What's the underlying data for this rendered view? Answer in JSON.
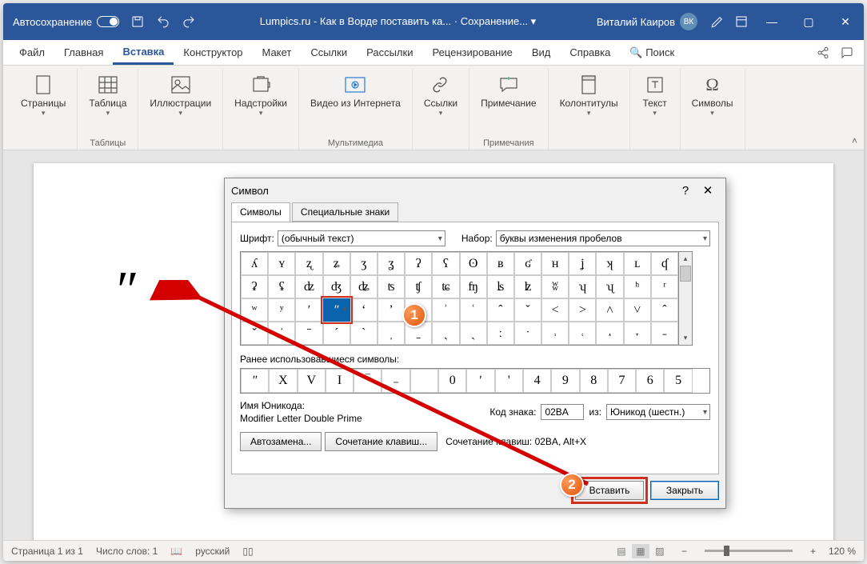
{
  "title": {
    "autosave": "Автосохранение",
    "doc": "Lumpics.ru - Как в Ворде поставить ка... · Сохранение... ▾",
    "user": "Виталий Каиров",
    "user_initials": "ВК"
  },
  "tabs": {
    "file": "Файл",
    "home": "Главная",
    "insert": "Вставка",
    "design": "Конструктор",
    "layout": "Макет",
    "references": "Ссылки",
    "mailings": "Рассылки",
    "review": "Рецензирование",
    "view": "Вид",
    "help": "Справка",
    "search": "Поиск"
  },
  "ribbon": {
    "pages": "Страницы",
    "tables": "Таблица",
    "tables_grp": "Таблицы",
    "illustrations": "Иллюстрации",
    "addins": "Надстройки",
    "video": "Видео из Интернета",
    "media_grp": "Мультимедиа",
    "links": "Ссылки",
    "comment": "Примечание",
    "comments_grp": "Примечания",
    "header": "Колонтитулы",
    "textbox": "Текст",
    "symbols": "Символы"
  },
  "page": {
    "text": "ʺ"
  },
  "status": {
    "page": "Страница 1 из 1",
    "words": "Число слов: 1",
    "lang": "русский",
    "zoom": "120 %"
  },
  "dlg": {
    "title": "Символ",
    "tab_sym": "Символы",
    "tab_spec": "Специальные знаки",
    "font_lbl": "Шрифт:",
    "font_val": "(обычный текст)",
    "set_lbl": "Набор:",
    "set_val": "буквы изменения пробелов",
    "grid": [
      [
        "ʎ",
        "ʏ",
        "ʐ",
        "ʑ",
        "ʒ",
        "ʓ",
        "ʔ",
        "ʕ",
        "ʘ",
        "ʙ",
        "ʛ",
        "ʜ",
        "ʝ",
        "ʞ",
        "ʟ",
        "ʠ"
      ],
      [
        "ʡ",
        "ʢ",
        "ʣ",
        "ʤ",
        "ʥ",
        "ʦ",
        "ʧ",
        "ʨ",
        "ʩ",
        "ʪ",
        "ʫ",
        "ʬ",
        "ʮ",
        "ʯ",
        "ʰ",
        "ʳ"
      ],
      [
        "ʷ",
        "ʸ",
        "ʹ",
        "ʺ",
        "ʻ",
        "ʼ",
        "ʽ",
        "ʾ",
        "ʿ",
        "ˆ",
        "ˇ",
        "˂",
        "˃",
        "˄",
        "˅",
        "ˆ"
      ],
      [
        "ˇ",
        "ˈ",
        "ˉ",
        "ˊ",
        "ˋ",
        "ˌ",
        "ˍ",
        "ˎ",
        "ˏ",
        "ː",
        "ˑ",
        "˒",
        "˓",
        "˔",
        "˕",
        "˗"
      ]
    ],
    "selected": [
      2,
      3
    ],
    "recent_lbl": "Ранее использовавшиеся символы:",
    "recent": [
      "ʺ",
      "X",
      "V",
      "I",
      "‾",
      "₋",
      " ",
      "0",
      "ʹ",
      "'",
      "4",
      "9",
      "8",
      "7",
      "6",
      "5"
    ],
    "uname_lbl": "Имя Юникода:",
    "uname_val": "Modifier Letter Double Prime",
    "code_lbl": "Код знака:",
    "code_val": "02BA",
    "from_lbl": "из:",
    "from_val": "Юникод (шестн.)",
    "auto": "Автозамена...",
    "short": "Сочетание клавиш...",
    "short_lbl": "Сочетание клавиш: 02BA, Alt+X",
    "insert": "Вставить",
    "close": "Закрыть"
  },
  "balloons": {
    "b1": "1",
    "b2": "2"
  }
}
